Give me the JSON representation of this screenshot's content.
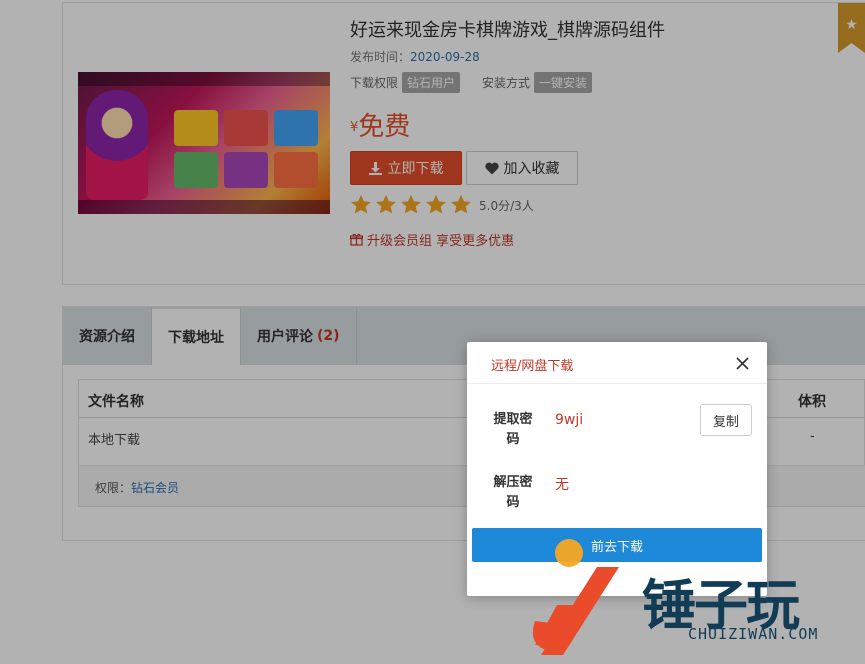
{
  "product": {
    "title": "好运来现金房卡棋牌游戏_棋牌源码组件",
    "publish_label": "发布时间：",
    "publish_date": "2020-09-28",
    "permission_label": "下载权限",
    "permission_value": "钻石用户",
    "install_label": "安装方式",
    "install_value": "一键安装",
    "price_symbol": "¥",
    "price": "免费",
    "download_button": "立即下载",
    "favorite_button": "加入收藏",
    "rating": {
      "stars_filled": 5,
      "stars_total": 5,
      "text": "5.0分/3人"
    },
    "upgrade_text": "升级会员组 享受更多优惠",
    "badge_icon": "star-icon"
  },
  "tabs": [
    {
      "label": "资源介绍",
      "active": false
    },
    {
      "label": "下载地址",
      "active": true
    },
    {
      "label": "用户评论",
      "count": "(2)",
      "active": false
    }
  ],
  "file_table": {
    "header_name": "文件名称",
    "header_size": "体积",
    "rows": [
      {
        "name": "本地下载",
        "size": "-"
      }
    ],
    "permission_label": "权限：",
    "permission_value": "钻石会员"
  },
  "modal": {
    "title": "远程/网盘下载",
    "close_icon": "close-icon",
    "extract_label": "提取密码",
    "extract_value": "9wji",
    "copy_button": "复制",
    "unzip_label": "解压密码",
    "unzip_value": "无",
    "go_button": "前去下载"
  },
  "watermark": {
    "text": "锤子玩",
    "sub": "CHUIZIWAN.COM"
  },
  "colors": {
    "accent_red": "#e4502c",
    "link_blue": "#2a6fb0",
    "primary_blue": "#1e88d9",
    "star_gold": "#f5a623",
    "badge_gold": "#d69b2b"
  }
}
